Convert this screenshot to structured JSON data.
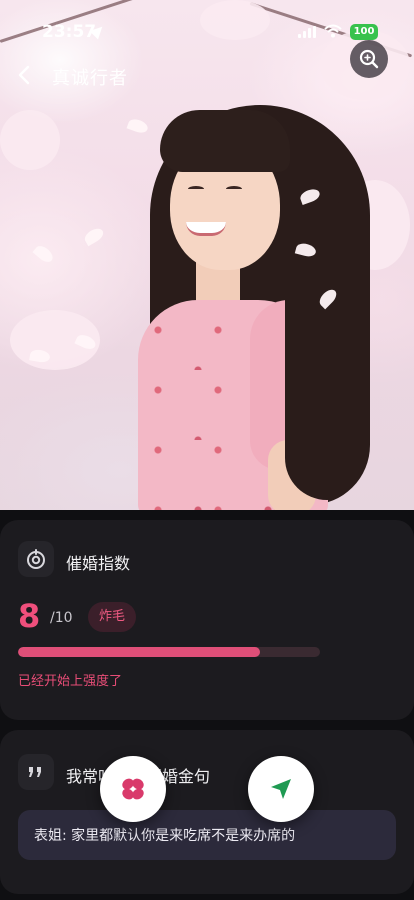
{
  "status_bar": {
    "time": "23:57",
    "battery": "100"
  },
  "nav": {
    "title": "真诚行者"
  },
  "index_card": {
    "title": "催婚指数",
    "score": "8",
    "score_max": "/10",
    "badge": "炸毛",
    "progress_fraction": 0.8,
    "hint": "已经开始上强度了"
  },
  "quote_card": {
    "title": "我常听到的催婚金句",
    "quote": "表姐: 家里都默认你是来吃席不是来办席的"
  },
  "icons": {
    "back": "chevron-left-icon",
    "search": "search-icon",
    "index": "gauge-icon",
    "quote": "quote-icon",
    "flower": "flower-icon",
    "send": "send-icon",
    "location": "location-arrow-icon"
  },
  "colors": {
    "accent": "#ef4f7c",
    "card": "#1c1b1f",
    "background": "#0f0f12",
    "send_green": "#1f9a52",
    "flower_pink": "#d93a6b",
    "battery_green": "#38c24d"
  }
}
